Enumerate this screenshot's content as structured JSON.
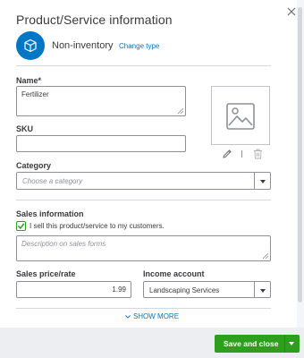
{
  "panel": {
    "title": "Product/Service information"
  },
  "type": {
    "icon": "cube-icon",
    "name": "Non-inventory",
    "change_label": "Change type"
  },
  "fields": {
    "name": {
      "label": "Name*",
      "value": "Fertilizer"
    },
    "sku": {
      "label": "SKU",
      "value": ""
    },
    "category": {
      "label": "Category",
      "placeholder": "Choose a category"
    }
  },
  "image": {
    "icon": "image-placeholder-icon",
    "edit_icon": "pencil-icon",
    "delete_icon": "trash-icon"
  },
  "sales": {
    "section_label": "Sales information",
    "checkbox_label": "I sell this product/service to my customers.",
    "checked": true,
    "description_placeholder": "Description on sales forms",
    "price_label": "Sales price/rate",
    "price_value": "1.99",
    "income_label": "Income account",
    "income_value": "Landscaping Services"
  },
  "show_more": {
    "label": "SHOW MORE"
  },
  "footer": {
    "save_label": "Save and close"
  },
  "colors": {
    "accent_blue": "#0077c5",
    "primary_green": "#2ca01c",
    "footer_bg": "#eceef1"
  }
}
